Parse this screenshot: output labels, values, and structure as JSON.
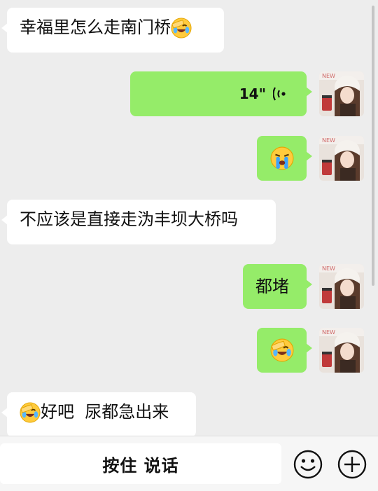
{
  "messages": [
    {
      "side": "in",
      "type": "text",
      "text": "幸福里怎么走南门桥",
      "trailing_emoji": "facepalm-laugh-emoji"
    },
    {
      "side": "out",
      "type": "voice",
      "duration": "14\"",
      "icon": "voice-waves-icon"
    },
    {
      "side": "out",
      "type": "emoji",
      "emoji": "crying-emoji"
    },
    {
      "side": "in",
      "type": "text",
      "text": "不应该是直接走沩丰坝大桥吗"
    },
    {
      "side": "out",
      "type": "text",
      "text": "都堵"
    },
    {
      "side": "out",
      "type": "emoji",
      "emoji": "facepalm-laugh-emoji"
    },
    {
      "side": "in",
      "type": "text",
      "text": "好吧  尿都急出来",
      "leading_emoji": "facepalm-laugh-emoji"
    }
  ],
  "input_bar": {
    "hold_to_talk_label": "按住 说话",
    "emoji_button_icon": "smiley-icon",
    "more_button_icon": "plus-circle-icon"
  },
  "colors": {
    "background": "#ededed",
    "outgoing_bubble": "#95ec69",
    "incoming_bubble": "#ffffff"
  }
}
